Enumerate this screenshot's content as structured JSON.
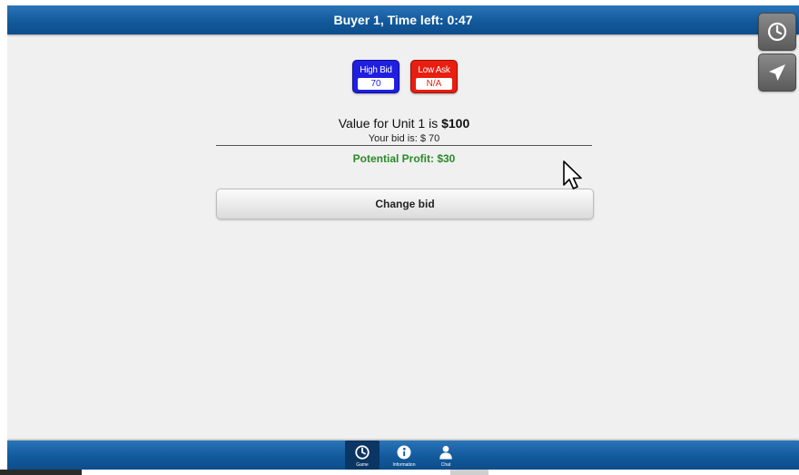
{
  "header": {
    "title": "Buyer 1, Time left: 0:47"
  },
  "side_buttons": [
    {
      "icon": "clock-icon"
    },
    {
      "icon": "paper-plane-icon"
    }
  ],
  "market": {
    "high_bid": {
      "label": "High Bid",
      "value": "70",
      "color": "#1f1fe0"
    },
    "low_ask": {
      "label": "Low Ask",
      "value": "N/A",
      "color": "#e81e10"
    }
  },
  "unit": {
    "value_prefix": "Value for Unit 1 is ",
    "value_amount": "$100",
    "your_bid": "Your bid is: $ 70",
    "potential_profit": "Potential Profit: $30",
    "profit_color": "#2a8a2a"
  },
  "actions": {
    "change_bid_label": "Change bid"
  },
  "bottom_nav": {
    "items": [
      {
        "label": "Game",
        "icon": "clock-icon",
        "active": true
      },
      {
        "label": "Information",
        "icon": "info-icon",
        "active": false
      },
      {
        "label": "Chat",
        "icon": "person-icon",
        "active": false
      }
    ]
  },
  "colors": {
    "header_blue": "#125a9c",
    "background": "#f0f0f0"
  }
}
